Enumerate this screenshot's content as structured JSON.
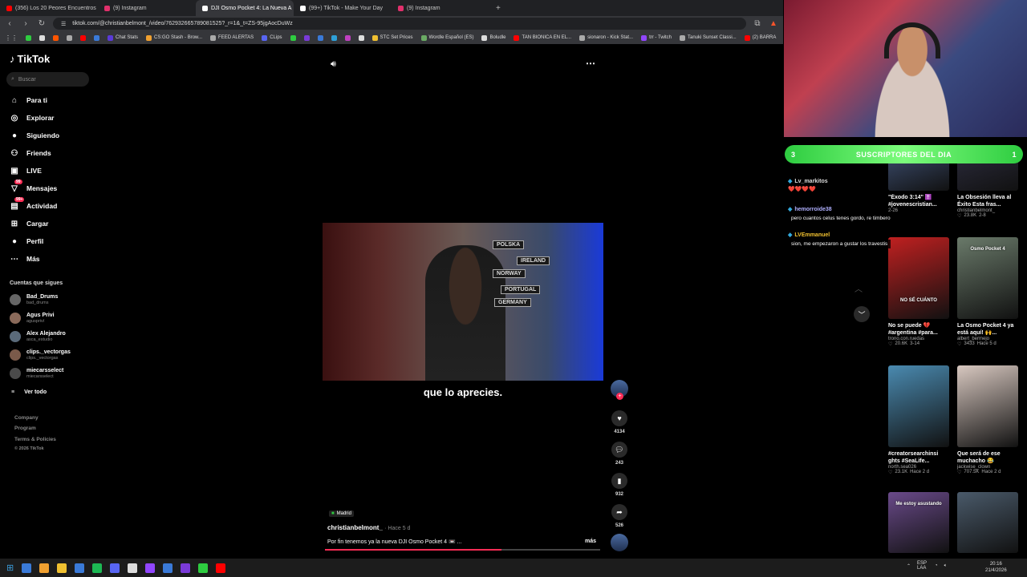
{
  "browser": {
    "tabs": [
      {
        "title": "(356) Los 20 Peores Encuentros Capt",
        "color": "#ff0000"
      },
      {
        "title": "(9) Instagram",
        "color": "#e1306c"
      },
      {
        "title": "DJI Osmo Pocket 4: La Nueva A",
        "color": "#ffffff",
        "active": true
      },
      {
        "title": "(99+) TikTok - Make Your Day",
        "color": "#ffffff"
      },
      {
        "title": "(9) Instagram",
        "color": "#e1306c"
      }
    ],
    "new_tab": "+",
    "url": "tiktok.com/@christianbelmont_/video/762932665789081525?_r=1&_t=ZS-95jgAocDuWz",
    "bookmarks": [
      {
        "label": "",
        "color": "#2ecc40"
      },
      {
        "label": "",
        "color": "#dddddd"
      },
      {
        "label": "",
        "color": "#ff5500"
      },
      {
        "label": "",
        "color": "#aaaaaa"
      },
      {
        "label": "",
        "color": "#ff0000"
      },
      {
        "label": "",
        "color": "#3a7ad8"
      },
      {
        "label": "Chat Stats",
        "color": "#5a3ad8"
      },
      {
        "label": "CS:GO Stash - Brow...",
        "color": "#f0a030"
      },
      {
        "label": "FEED ALERTAS",
        "color": "#aaaaaa"
      },
      {
        "label": "CLips",
        "color": "#5865f2"
      },
      {
        "label": "",
        "color": "#2ecc40"
      },
      {
        "label": "",
        "color": "#7a3ad8"
      },
      {
        "label": "",
        "color": "#3a7ad8"
      },
      {
        "label": "",
        "color": "#2ea0d8"
      },
      {
        "label": "",
        "color": "#c040c0"
      },
      {
        "label": "",
        "color": "#dddddd"
      },
      {
        "label": "STC Set Prices",
        "color": "#f0c030"
      },
      {
        "label": "Wordle Español (ES)",
        "color": "#6aaa64"
      },
      {
        "label": "Boludle",
        "color": "#dddddd"
      },
      {
        "label": "TAN BIONICA EN EL...",
        "color": "#ff0000"
      },
      {
        "label": "sionaron - Kick Stat...",
        "color": "#aaaaaa"
      },
      {
        "label": "trr - Twitch",
        "color": "#9146ff"
      },
      {
        "label": "Tanuki Sunset Classi...",
        "color": "#aaaaaa"
      },
      {
        "label": "(2) BARRA",
        "color": "#ff0000"
      }
    ]
  },
  "tiktok": {
    "logo": "TikTok",
    "search_placeholder": "Buscar",
    "nav": [
      {
        "label": "Para ti",
        "icon": "home-icon",
        "glyph": "⌂"
      },
      {
        "label": "Explorar",
        "icon": "compass-icon",
        "glyph": "◎"
      },
      {
        "label": "Siguiendo",
        "icon": "avatar-icon",
        "glyph": "●"
      },
      {
        "label": "Friends",
        "icon": "friends-icon",
        "glyph": "⚇"
      },
      {
        "label": "LIVE",
        "icon": "live-icon",
        "glyph": "▣"
      },
      {
        "label": "Mensajes",
        "icon": "messages-icon",
        "glyph": "▽",
        "badge": "99"
      },
      {
        "label": "Actividad",
        "icon": "activity-icon",
        "glyph": "▤",
        "badge": "99+"
      },
      {
        "label": "Cargar",
        "icon": "upload-icon",
        "glyph": "⊞"
      },
      {
        "label": "Perfil",
        "icon": "profile-icon",
        "glyph": "●"
      },
      {
        "label": "Más",
        "icon": "more-icon",
        "glyph": "⋯"
      }
    ],
    "following_title": "Cuentas que sigues",
    "following": [
      {
        "name": "Bad_Drums",
        "handle": "bad_drums"
      },
      {
        "name": "Agus Privi",
        "handle": "aguspriví"
      },
      {
        "name": "Alex Alejandro",
        "handle": "asca_estudio"
      },
      {
        "name": "clips._vectorgas",
        "handle": "clips._vectorgas"
      },
      {
        "name": "miecarsselect",
        "handle": "miecarsselect"
      }
    ],
    "see_all": "Ver todo",
    "footer": [
      "Company",
      "Program",
      "Terms & Policies",
      "© 2026 TikTok"
    ]
  },
  "video": {
    "flags": [
      "POLSKA",
      "IRELAND",
      "NORWAY",
      "PORTUGAL",
      "GERMANY"
    ],
    "caption": "que lo aprecies.",
    "location": "Madrid",
    "author": "christianbelmont_",
    "posted": "· Hace 5 d",
    "description": "Por fin tenemos ya la nueva DJI Osmo Pocket 4 📼 ...",
    "more": "más",
    "progress": 0.64,
    "likes": "4134",
    "comments": "243",
    "saves": "932",
    "shares": "526"
  },
  "related": [
    {
      "title": "\"Éxodo 3:14\" ✝️ #jovenescristian...",
      "user": "",
      "views": "",
      "age": "2-26",
      "color": "#3a4a6a"
    },
    {
      "title": "La Obsesión lleva al Éxito Esta fras...",
      "user": "christianbelmont_",
      "views": "23.8K",
      "age": "2-8",
      "color": "#2a2a3a"
    },
    {
      "title": "No se puede 💔 #argentina #para...",
      "user": "trono.con.ruedas",
      "views": "20.6K",
      "age": "3-14",
      "color": "#c02020",
      "overlay": "NO SÉ CUÁNTO"
    },
    {
      "title": "La Osmo Pocket 4 ya está aquí! 🙌...",
      "user": "albert_bermejo",
      "views": "3433",
      "age": "Hace 5 d",
      "color": "#6a7a6a",
      "overlay": "Osmo Pocket 4"
    },
    {
      "title": "#creatorsearchinsi ghts #SeaLife...",
      "user": "north.sea026",
      "views": "23.1K",
      "age": "Hace 2 d",
      "color": "#4a8ab0"
    },
    {
      "title": "Que será de ese muchacho 😂",
      "user": "jackwise_clown",
      "views": "707.5K",
      "age": "Hace 2 d",
      "color": "#d8c8c0"
    },
    {
      "title": "",
      "user": "",
      "views": "",
      "age": "",
      "color": "#6a4a8a",
      "overlay": "Me estoy asustando"
    },
    {
      "title": "",
      "user": "",
      "views": "",
      "age": "",
      "color": "#4a5a6a"
    }
  ],
  "stream": {
    "sub_count_left": "3",
    "sub_label": "SUSCRIPTORES DEL DIA",
    "sub_count_right": "1",
    "chat": [
      {
        "user": "Lv_markitos",
        "msg": "",
        "color": "#dddddd"
      },
      {
        "user": "hemorroide38",
        "msg": "pero cuantos celus tenes gordo, re timbero",
        "color": "#b0b0ff"
      },
      {
        "user": "LVEmmanuel",
        "msg": "sion, me empezaron a gustar los travestis",
        "color": "#f0c030"
      }
    ]
  },
  "taskbar": {
    "icons": [
      "#3a7ad8",
      "#f0a030",
      "#f0c030",
      "#3a7ad8",
      "#1db954",
      "#5865f2",
      "#dddddd",
      "#9146ff",
      "#3a7ad8",
      "#7a3ad8",
      "#2ecc40",
      "#ff0000"
    ],
    "lang": "ESP LAA",
    "time": "20:16",
    "date": "21/4/2026"
  }
}
